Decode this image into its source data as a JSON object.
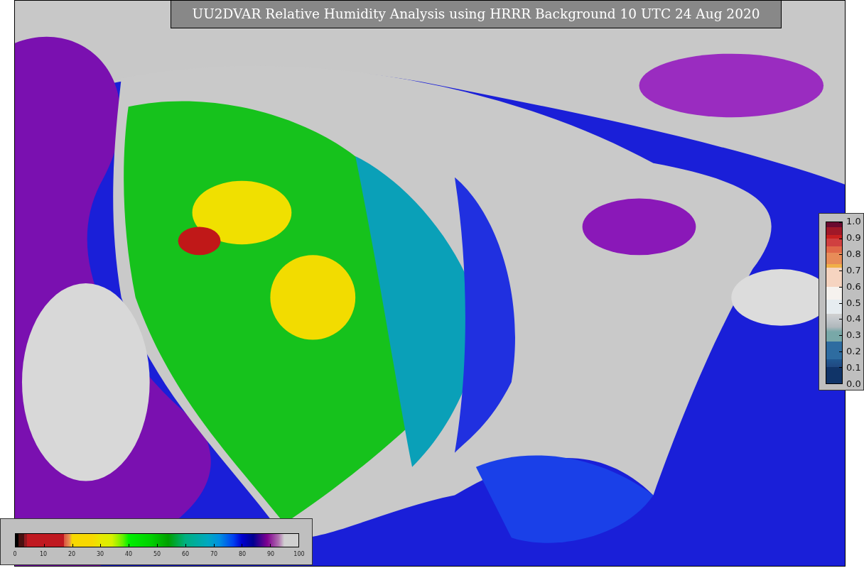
{
  "title": "UU2DVAR Relative Humidity Analysis using HRRR Background 10 UTC 24 Aug 2020",
  "humidity_colorbar": {
    "ticks": [
      "0",
      "10",
      "20",
      "30",
      "40",
      "50",
      "60",
      "70",
      "80",
      "90",
      "100"
    ]
  },
  "observation_colorbar": {
    "ticks": [
      "1.0",
      "0.9",
      "0.8",
      "0.7",
      "0.6",
      "0.5",
      "0.4",
      "0.3",
      "0.2",
      "0.1",
      "0.0"
    ]
  }
}
